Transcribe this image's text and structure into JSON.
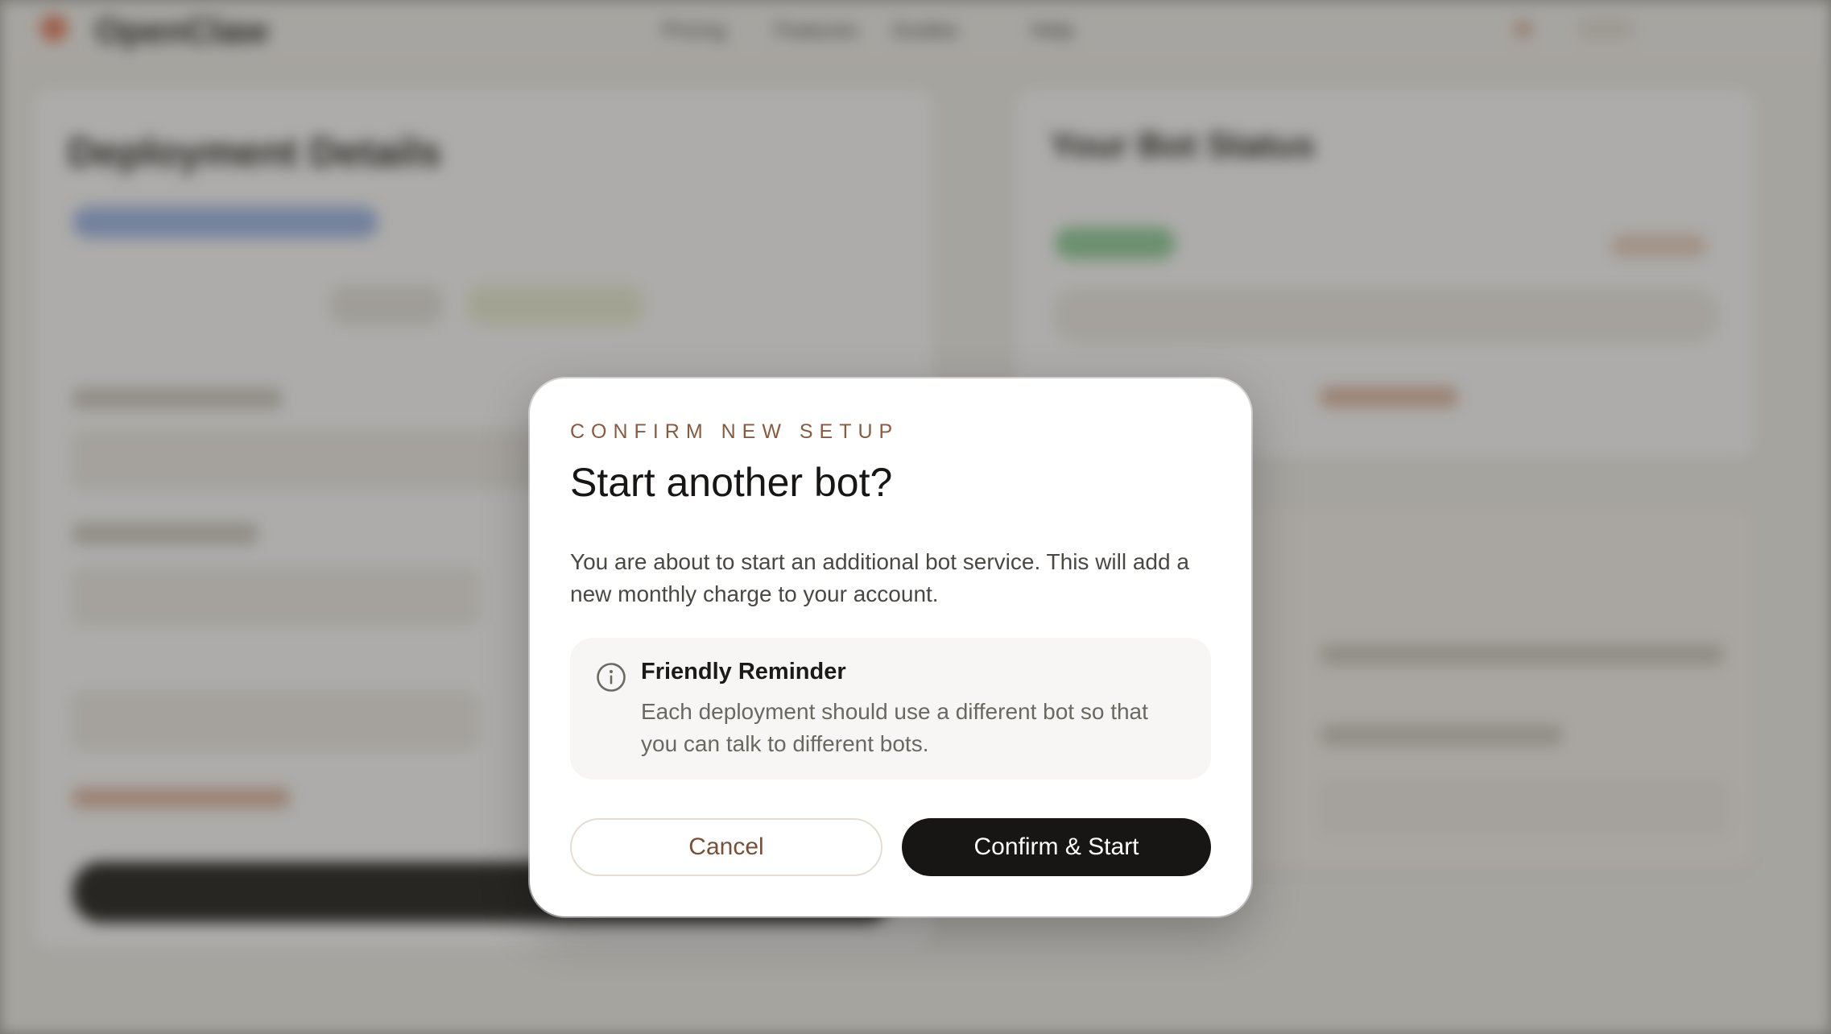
{
  "background": {
    "app_name": "OpenClaw",
    "nav": [
      "Pricing",
      "Features",
      "Guides",
      "Help"
    ],
    "left_panel_title": "Deployment Details",
    "right_panel_title": "Your Bot Status"
  },
  "dialog": {
    "eyebrow": "CONFIRM NEW SETUP",
    "title": "Start another bot?",
    "body": "You are about to start an additional bot service. This will add a new monthly charge to your account.",
    "reminder": {
      "icon": "info-icon",
      "title": "Friendly Reminder",
      "text": "Each deployment should use a different bot so that you can talk to different bots."
    },
    "cancel_label": "Cancel",
    "confirm_label": "Confirm & Start"
  },
  "colors": {
    "accent_brown": "#8b5a3c",
    "confirm_button": "#171614",
    "scrim": "rgba(60,58,52,0.42)"
  }
}
